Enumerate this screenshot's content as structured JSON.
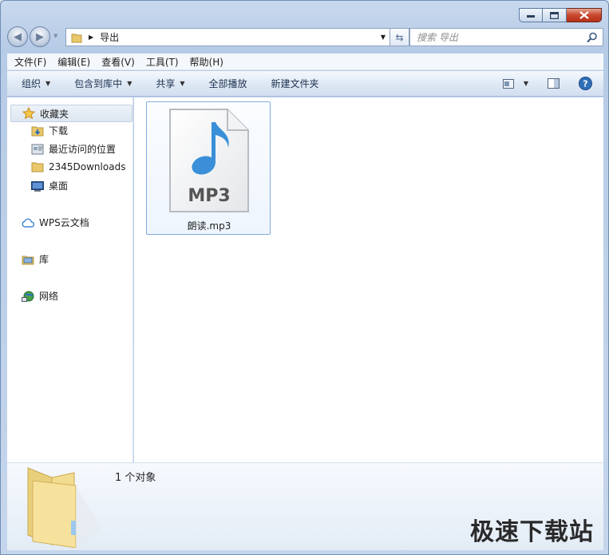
{
  "address": {
    "current_folder": "导出"
  },
  "search": {
    "placeholder": "搜索 导出"
  },
  "menu": [
    "文件(F)",
    "编辑(E)",
    "查看(V)",
    "工具(T)",
    "帮助(H)"
  ],
  "toolbar": {
    "organize": "组织",
    "include_in_library": "包含到库中",
    "share": "共享",
    "play_all": "全部播放",
    "new_folder": "新建文件夹"
  },
  "navigation": {
    "favorites": "收藏夹",
    "favorite_items": [
      "下载",
      "最近访问的位置",
      "2345Downloads",
      "桌面"
    ],
    "wps": "WPS云文档",
    "libraries": "库",
    "network": "网络"
  },
  "files": [
    {
      "name": "朗读.mp3",
      "icon_text": "MP3"
    }
  ],
  "status": {
    "count": "1 个对象"
  },
  "watermark": "极速下载站",
  "colors": {
    "accent": "#3a8fd8",
    "selection_border": "#84acdd"
  }
}
